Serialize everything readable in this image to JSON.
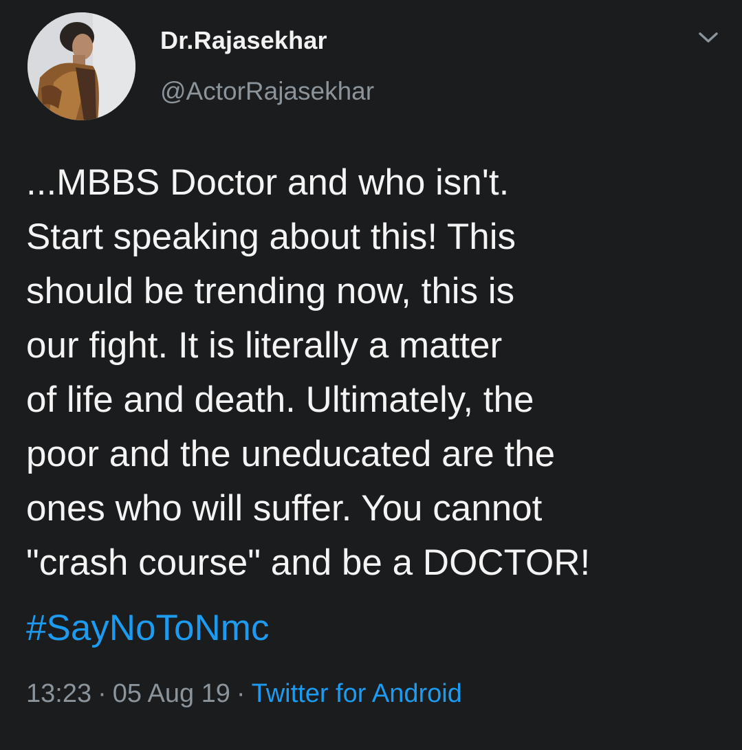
{
  "author": {
    "display_name": "Dr.Rajasekhar",
    "handle": "@ActorRajasekhar"
  },
  "tweet": {
    "body": "...MBBS Doctor and who isn't.\nStart speaking about this! This\nshould be trending now, this is\nour fight. It is literally a matter\nof life and death. Ultimately, the\npoor and the uneducated are the\nones who will suffer. You cannot\n\"crash course\" and be a DOCTOR!",
    "hashtag": "#SayNoToNmc",
    "time": "13:23",
    "separator": "·",
    "date": "05 Aug 19",
    "source": "Twitter for Android"
  },
  "icons": {
    "menu": "chevron-down-icon",
    "avatar": "profile-photo"
  },
  "colors": {
    "background": "#1b1c1e",
    "text": "#f4f4f4",
    "muted": "#8b949b",
    "link": "#1d9bf0"
  }
}
